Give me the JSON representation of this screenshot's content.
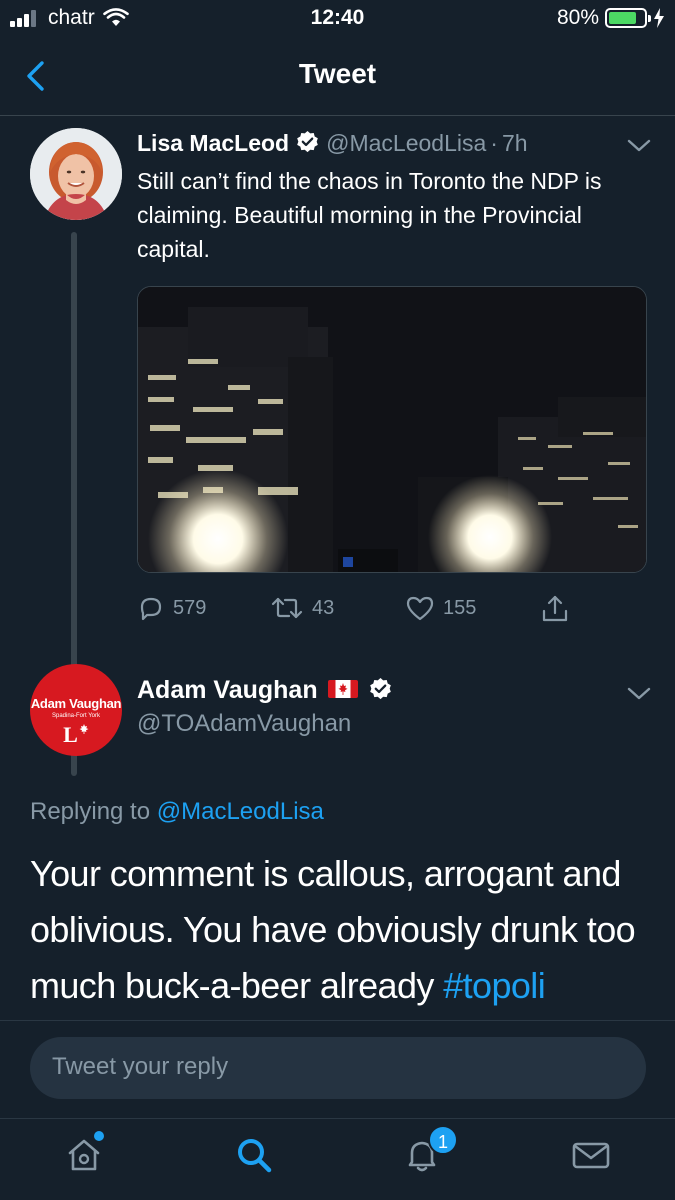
{
  "status_bar": {
    "carrier": "chatr",
    "time": "12:40",
    "battery_percent": "80%",
    "battery_level": 0.8,
    "icons": [
      "signal-icon",
      "wifi-icon",
      "battery-icon",
      "charging-icon"
    ]
  },
  "nav": {
    "title": "Tweet",
    "back_icon": "chevron-left-icon"
  },
  "tweet1": {
    "name": "Lisa MacLeod",
    "handle": "@MacLeodLisa",
    "separator": "·",
    "age": "7h",
    "text": "Still can’t find the chaos in Toronto the NDP is claiming.  Beautiful morning in the Provincial capital.",
    "counts": {
      "replies": "579",
      "retweets": "43",
      "likes": "155"
    }
  },
  "tweet2": {
    "name": "Adam Vaughan",
    "handle": "@TOAdamVaughan",
    "avatar_name": "Adam Vaughan",
    "avatar_sub": "Spadina-Fort York",
    "avatar_logo": "L",
    "replying_prefix": "Replying to",
    "replying_to": "@MacLeodLisa",
    "text": "Your comment is callous, arrogant and oblivious. You have obviously drunk too much buck-a-beer already",
    "hashtag": "#topoli"
  },
  "reply_bar": {
    "placeholder": "Tweet your reply"
  },
  "tab_bar": {
    "notifications_badge": "1",
    "tabs": [
      "home-icon",
      "search-icon",
      "notifications-icon",
      "messages-icon"
    ]
  },
  "colors": {
    "background": "#15202b",
    "accent": "#1da1f2",
    "secondary_text": "#8899a6",
    "divider": "#38444d",
    "battery_green": "#4cd964"
  }
}
